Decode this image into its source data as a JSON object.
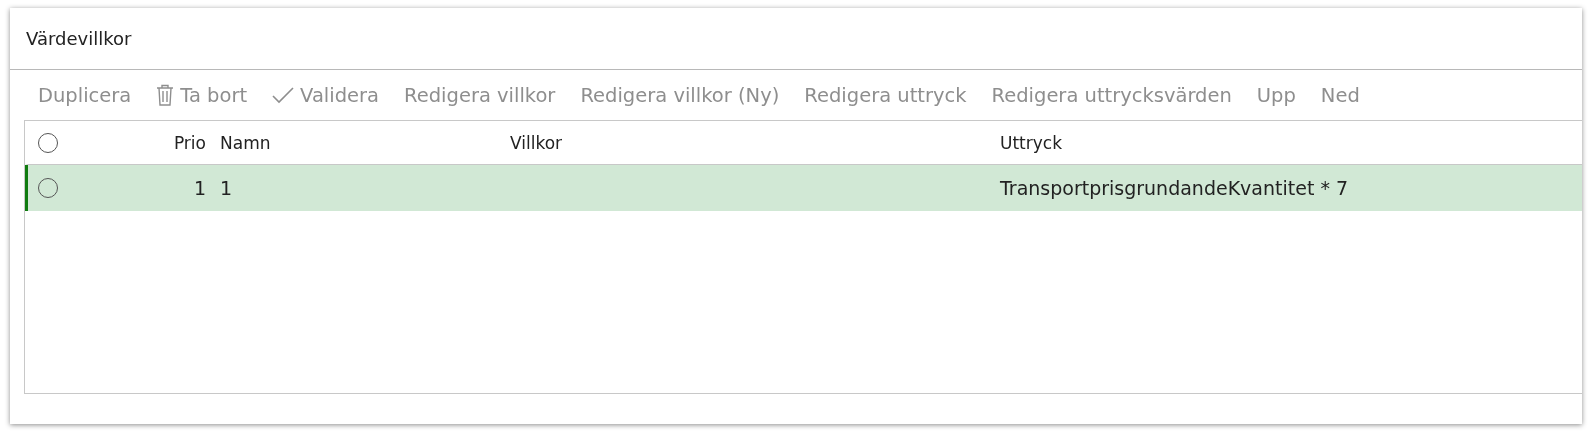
{
  "panel": {
    "title": "Värdevillkor"
  },
  "toolbar": [
    {
      "label": "Duplicera",
      "disabled": true
    },
    {
      "label": "Ta bort",
      "disabled": true
    },
    {
      "label": "Validera",
      "disabled": true
    },
    {
      "label": "Redigera villkor",
      "disabled": true
    },
    {
      "label": "Redigera villkor (Ny)",
      "disabled": true
    },
    {
      "label": "Redigera uttryck",
      "disabled": true
    },
    {
      "label": "Redigera uttrycksvärden",
      "disabled": true
    },
    {
      "label": "Upp",
      "disabled": true
    },
    {
      "label": "Ned",
      "disabled": true
    }
  ],
  "table": {
    "select_all": {
      "checked": false
    },
    "columns": [
      "Prio",
      "Namn",
      "Villkor",
      "Uttryck"
    ],
    "rows": [
      {
        "selected": true,
        "checked": false,
        "cells": [
          "1",
          "1",
          "",
          "TransportprisgrundandeKvantitet * 7"
        ]
      }
    ]
  }
}
